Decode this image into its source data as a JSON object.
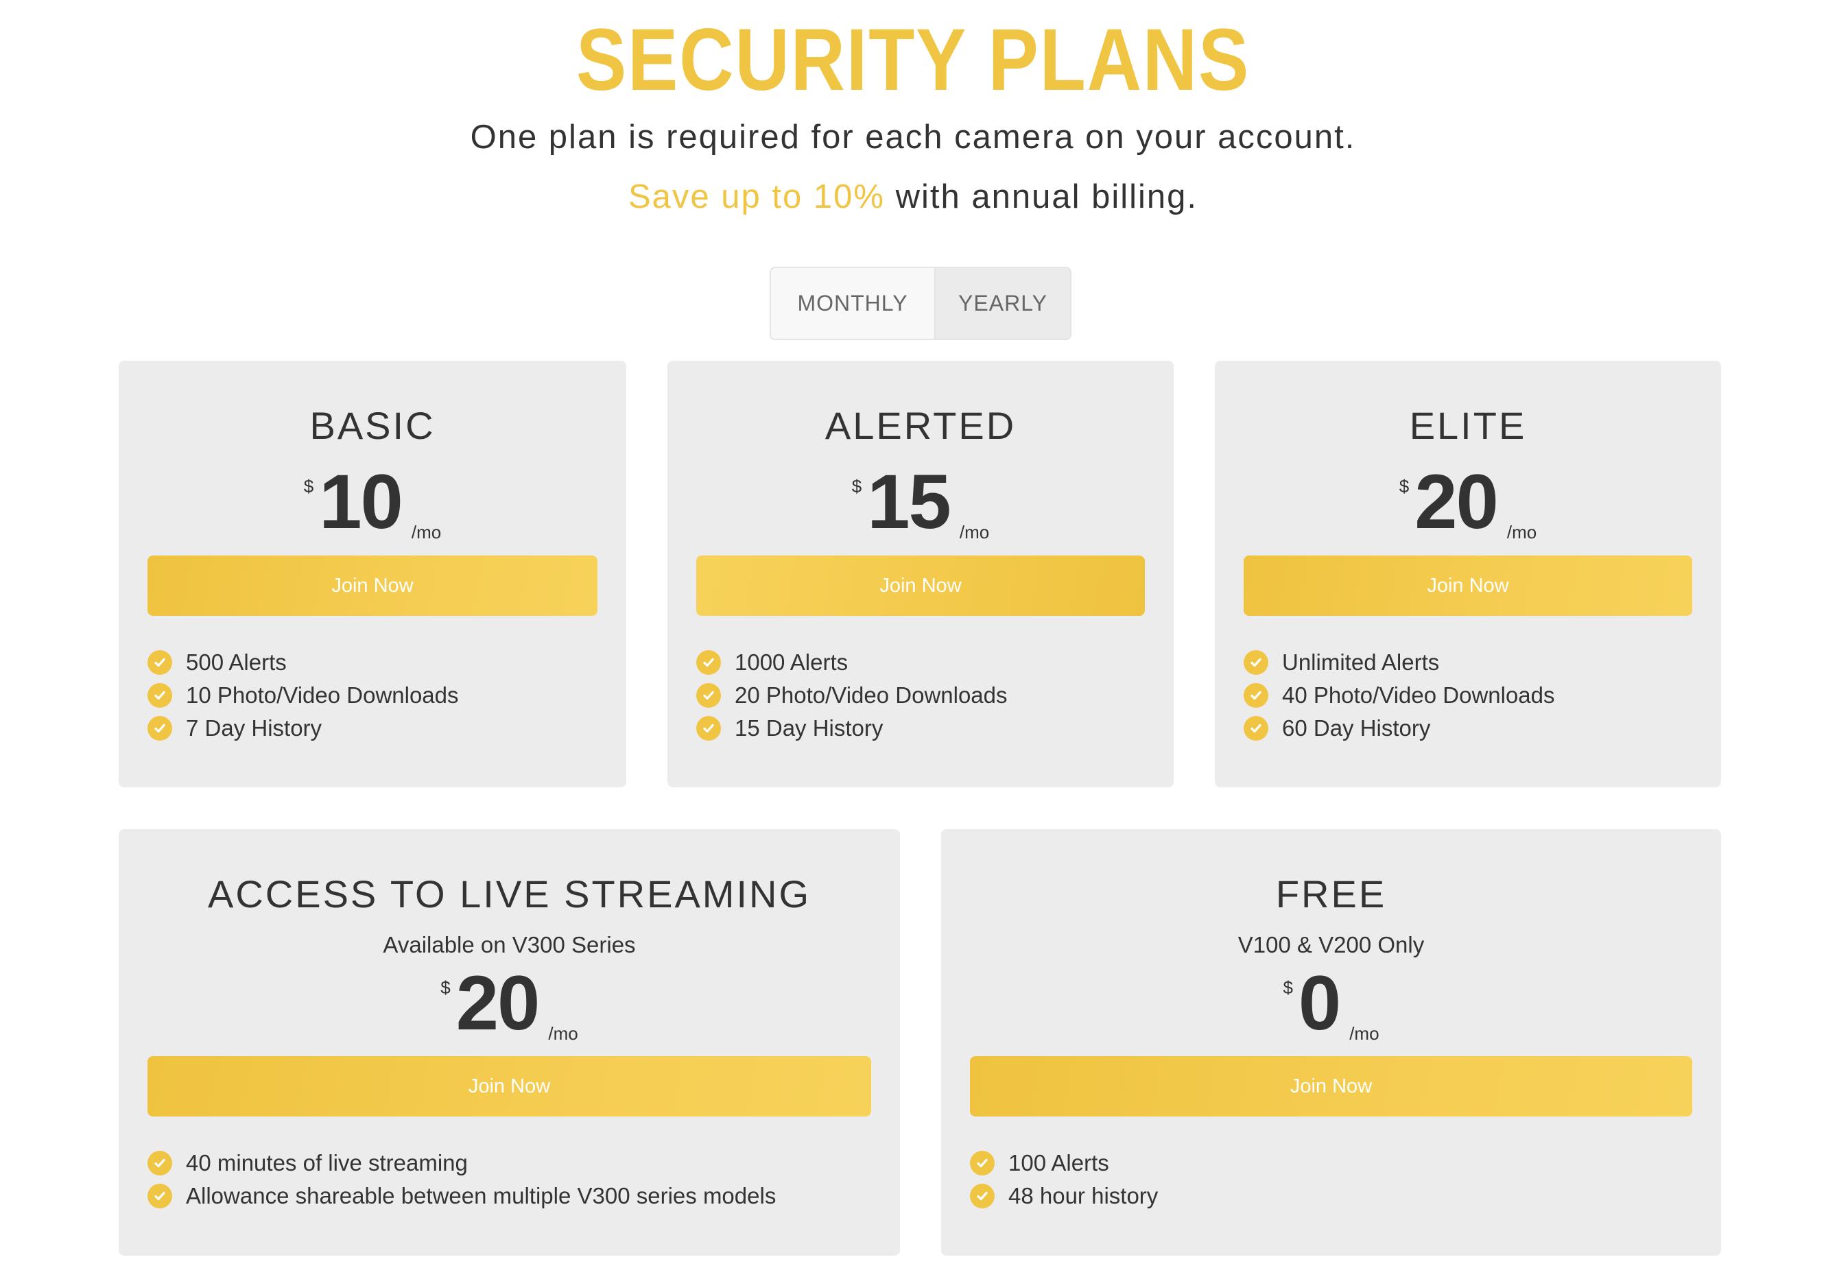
{
  "header": {
    "title": "SECURITY PLANS",
    "subtitle": "One plan is required for each camera on your account.",
    "savings_highlight": "Save up to 10%",
    "savings_rest": " with annual billing."
  },
  "billing_toggle": {
    "options": [
      "MONTHLY",
      "YEARLY"
    ],
    "selected": "YEARLY"
  },
  "colors": {
    "accent": "#f0c543",
    "card_bg": "#ececec",
    "text": "#333333"
  },
  "plans": [
    {
      "name": "BASIC",
      "currency": "$",
      "amount": "10",
      "period": "/mo",
      "cta": "Join Now",
      "features": [
        "500 Alerts",
        "10 Photo/Video Downloads",
        "7 Day History"
      ]
    },
    {
      "name": "ALERTED",
      "currency": "$",
      "amount": "15",
      "period": "/mo",
      "cta": "Join Now",
      "features": [
        "1000 Alerts",
        "20 Photo/Video Downloads",
        "15 Day History"
      ]
    },
    {
      "name": "ELITE",
      "currency": "$",
      "amount": "20",
      "period": "/mo",
      "cta": "Join Now",
      "features": [
        "Unlimited Alerts",
        "40 Photo/Video Downloads",
        "60 Day History"
      ]
    },
    {
      "name": "ACCESS TO LIVE STREAMING",
      "subtitle": "Available on V300 Series",
      "currency": "$",
      "amount": "20",
      "period": "/mo",
      "cta": "Join Now",
      "features": [
        "40 minutes of live streaming",
        "Allowance shareable between multiple V300 series models"
      ]
    },
    {
      "name": "FREE",
      "subtitle": "V100 & V200 Only",
      "currency": "$",
      "amount": "0",
      "period": "/mo",
      "cta": "Join Now",
      "features": [
        "100 Alerts",
        "48 hour history"
      ]
    }
  ]
}
